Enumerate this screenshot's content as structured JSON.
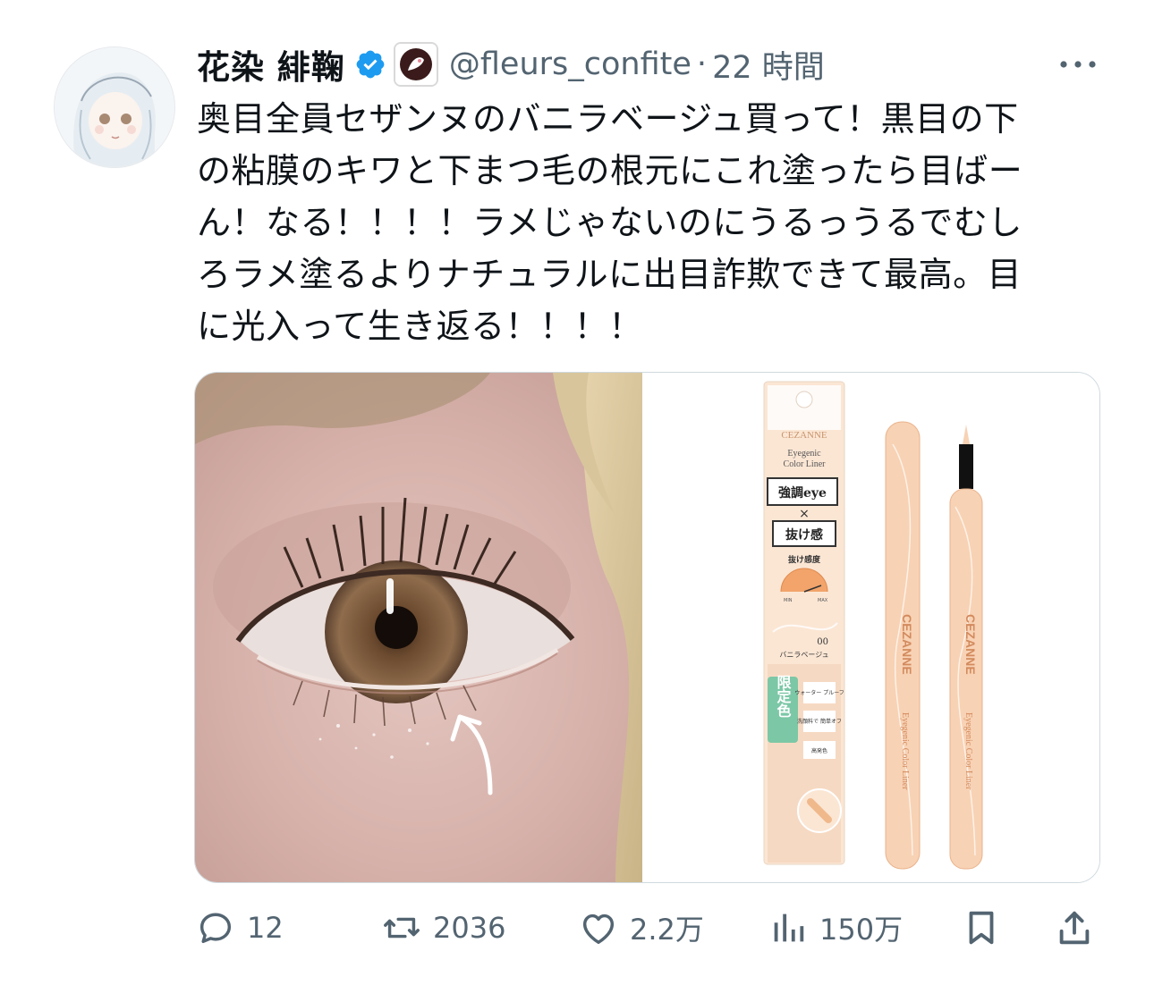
{
  "tweet": {
    "author_name": "花染 緋鞠",
    "handle": "@fleurs_confite",
    "separator": "·",
    "time": "22 時間",
    "text": "奥目全員セザンヌのバニラベージュ買って！黒目の下\nの粘膜のキワと下まつ毛の根元にこれ塗ったら目ばー\nん！なる！！！！ラメじゃないのにうるっうるでむし\nろラメ塗るよりナチュラルに出目詐欺できて最高。目\nに光入って生き返る！！！！"
  },
  "product": {
    "brand": "CEZANNE",
    "line1": "Eyegenic",
    "line2": "Color Liner",
    "badge1": "強調eye",
    "badge_x": "×",
    "badge2": "抜け感",
    "meter_title": "抜け感度",
    "meter_min": "MIN",
    "meter_max": "MAX",
    "shade_no": "00",
    "shade_name": "バニラベージュ",
    "limited": "限定色",
    "feature1": "ウォーター\nプルーフ",
    "feature2": "洗顔料で\n簡単オフ",
    "feature3": "高発色",
    "pen_text": "CEZANNE",
    "pen_sub": "Eyegenic  Color  Liner"
  },
  "actions": {
    "replies": "12",
    "retweets": "2036",
    "likes": "2.2万",
    "views": "150万"
  },
  "colors": {
    "accent": "#1d9bf0",
    "muted": "#536471",
    "peach": "#f8d2b4",
    "peach_dark": "#e9b38c"
  },
  "icons": [
    "verified-badge-icon",
    "more-icon",
    "reply-icon",
    "retweet-icon",
    "like-icon",
    "views-icon",
    "bookmark-icon",
    "share-icon"
  ]
}
